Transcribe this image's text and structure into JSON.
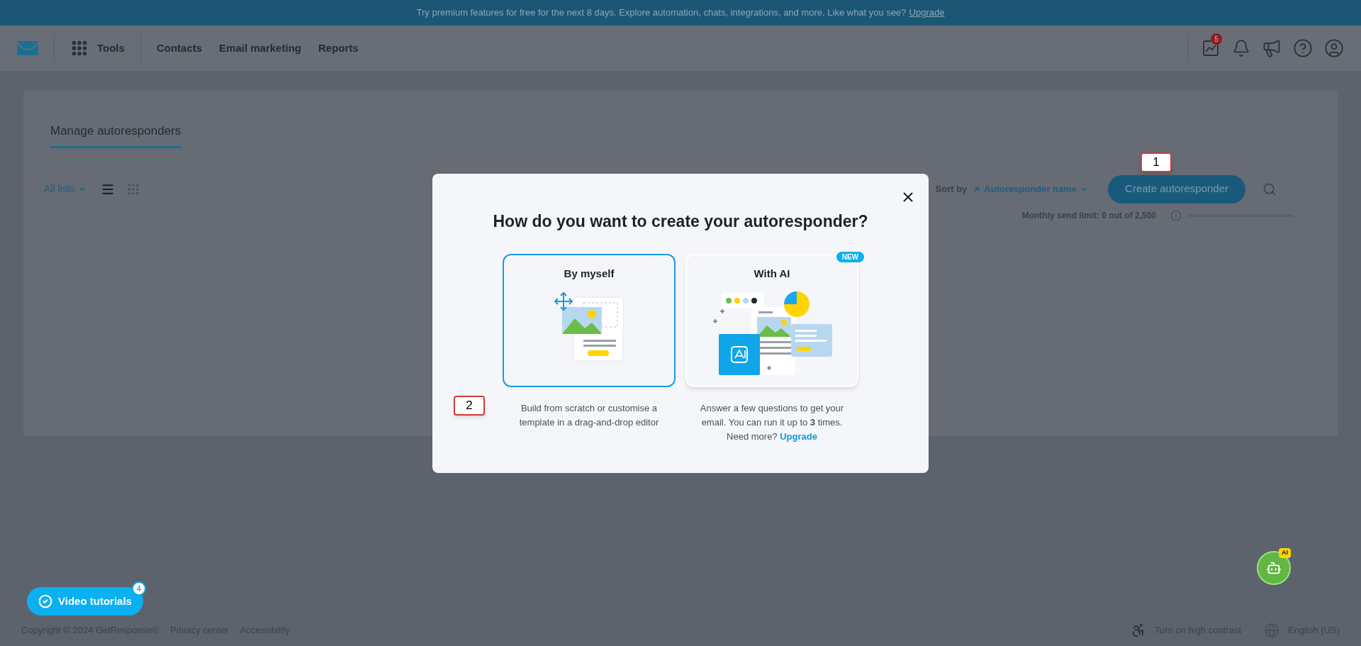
{
  "banner": {
    "text": "Try premium features for free for the next 8 days. Explore automation, chats, integrations, and more. Like what you see?",
    "link": "Upgrade"
  },
  "header": {
    "tools_label": "Tools",
    "nav": [
      {
        "label": "Contacts"
      },
      {
        "label": "Email marketing"
      },
      {
        "label": "Reports"
      }
    ],
    "notification_count": "5"
  },
  "page": {
    "tabs": [
      {
        "label": "Manage autoresponders",
        "selected": true
      }
    ],
    "list_filter": "All lists",
    "view_modes": [
      {
        "kind": "list",
        "selected": true
      },
      {
        "kind": "grid",
        "selected": false
      }
    ],
    "sort_label": "Sort by",
    "sort_value": "Autoresponder name",
    "create_button": "Create autoresponder",
    "send_limit": {
      "text": "Monthly send limit: 0 out of 2,500",
      "level": 0
    }
  },
  "modal": {
    "title": "How do you want to create your autoresponder?",
    "options": [
      {
        "kind": "manual",
        "title": "By myself",
        "selected": true,
        "description": "Build from scratch or customise a template in a drag-and-drop editor"
      },
      {
        "kind": "ai",
        "title": "With AI",
        "selected": false,
        "badge": "NEW",
        "description": "Answer a few questions to get your email. You can run it up to **3** times. Need more?",
        "link": "Upgrade"
      }
    ]
  },
  "annotations": [
    {
      "label": "1"
    },
    {
      "label": "2"
    }
  ],
  "video_tutorials": {
    "label": "Video tutorials",
    "count": "4"
  },
  "assistant_badge": "AI",
  "footer": {
    "links": [
      "Copyright © 2024 GetResponse®",
      "Privacy center",
      "Accessibility"
    ],
    "contrast": "Turn on high contrast",
    "language": "English (US)"
  }
}
